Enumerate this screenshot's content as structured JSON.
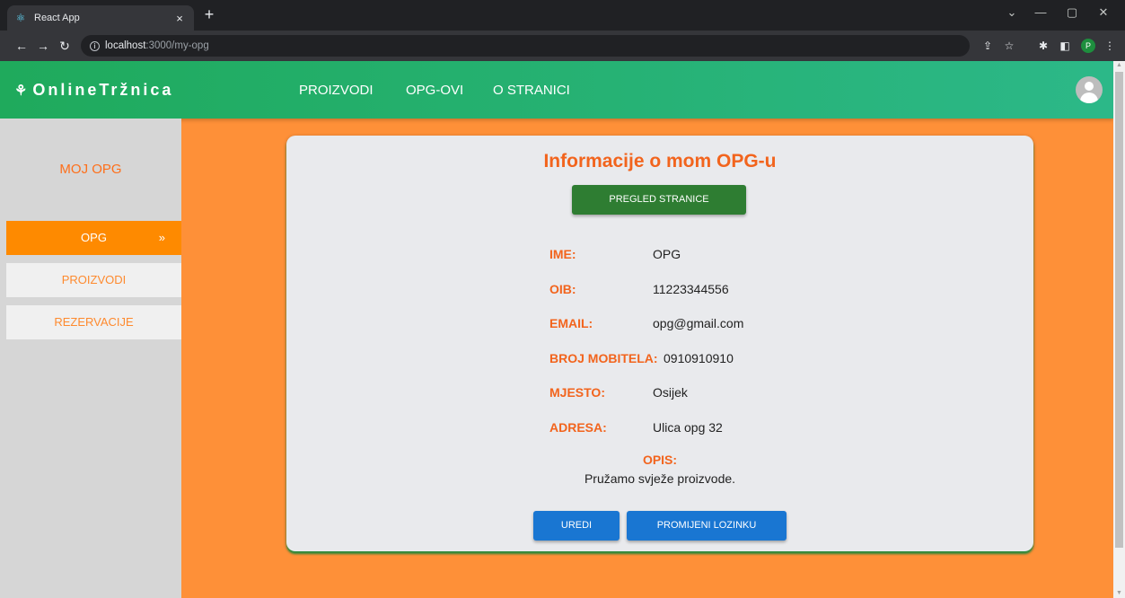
{
  "browser": {
    "tab_title": "React App",
    "tab_close": "×",
    "new_tab": "+",
    "url_host": "localhost",
    "url_path": ":3000/my-opg",
    "profile_initial": "P"
  },
  "appbar": {
    "brand": "OnlineTržnica",
    "nav": [
      "PROIZVODI",
      "OPG-OVI",
      "O STRANICI"
    ]
  },
  "sidebar": {
    "title": "MOJ OPG",
    "items": [
      {
        "label": "OPG",
        "active": true
      },
      {
        "label": "PROIZVODI",
        "active": false
      },
      {
        "label": "REZERVACIJE",
        "active": false
      }
    ],
    "active_chevron": "»"
  },
  "card": {
    "title": "Informacije o mom OPG-u",
    "preview_button": "PREGLED STRANICE",
    "fields": [
      {
        "label": "IME:",
        "value": "OPG"
      },
      {
        "label": "OIB:",
        "value": "11223344556"
      },
      {
        "label": "EMAIL:",
        "value": "opg@gmail.com"
      },
      {
        "label": "BROJ MOBITELA:",
        "value": "0910910910"
      },
      {
        "label": "MJESTO:",
        "value": "Osijek"
      },
      {
        "label": "ADRESA:",
        "value": "Ulica opg 32"
      }
    ],
    "opis_label": "OPIS:",
    "opis_value": "Pružamo svježe proizvode.",
    "edit_button": "UREDI",
    "password_button": "PROMIJENI LOZINKU"
  },
  "colors": {
    "appbar_start": "#1faa5c",
    "appbar_end": "#2cb888",
    "page_bg": "#fe9038",
    "accent_orange": "#f2641d",
    "sidebar_active": "#fe8a00",
    "button_green": "#2e7d32",
    "button_blue": "#1976d2"
  },
  "icons": {
    "tab_favicon": "react-icon",
    "brand_icon": "sprout-icon",
    "avatar": "user-icon"
  }
}
